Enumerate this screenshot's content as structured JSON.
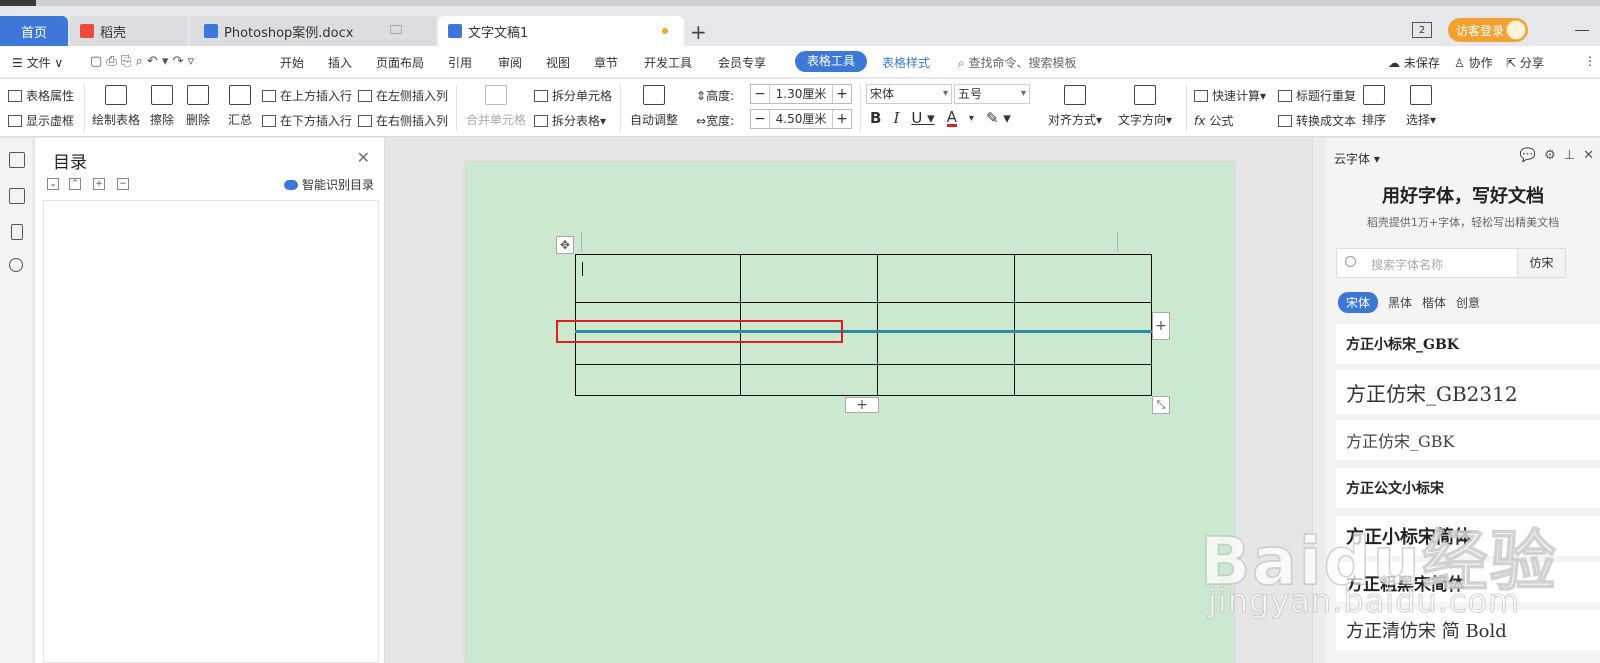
{
  "tabs": {
    "home": "首页",
    "tab2": "稻壳",
    "tab3": "Photoshop案例.docx",
    "tab4": "文字文稿1",
    "add": "+",
    "window_num": "2",
    "visitor": "访客登录"
  },
  "menu": {
    "file": "文件",
    "items": [
      "开始",
      "插入",
      "页面布局",
      "引用",
      "审阅",
      "视图",
      "章节",
      "开发工具",
      "会员专享"
    ],
    "table_tools": "表格工具",
    "table_style": "表格样式",
    "search_cmd": "查找命令、搜索模板",
    "unsaved": "未保存",
    "collab": "协作",
    "share": "分享"
  },
  "ribbon": {
    "table_props": "表格属性",
    "show_gridlines": "显示虚框",
    "draw_table": "绘制表格",
    "erase": "擦除",
    "delete": "删除",
    "summary": "汇总",
    "insert_above": "在上方插入行",
    "insert_below": "在下方插入行",
    "insert_left": "在左侧插入列",
    "insert_right": "在右侧插入列",
    "merge_cells": "合并单元格",
    "split_cells": "拆分单元格",
    "split_table": "拆分表格",
    "auto_adjust": "自动调整",
    "height_label": "高度:",
    "height_value": "1.30厘米",
    "width_label": "宽度:",
    "width_value": "4.50厘米",
    "font_name": "宋体",
    "font_size": "五号",
    "align": "对齐方式",
    "text_dir": "文字方向",
    "quick_calc": "快速计算",
    "header_repeat": "标题行重复",
    "formula": "公式",
    "to_text": "转换成文本",
    "sort": "排序",
    "select": "选择"
  },
  "toc": {
    "title": "目录",
    "ai_toc": "智能识别目录"
  },
  "fontpanel": {
    "header": "云字体",
    "title": "用好字体，写好文档",
    "subtitle": "稻壳提供1万+字体，轻松写出精美文档",
    "search_placeholder": "搜索字体名称",
    "search_button": "仿宋",
    "categories": [
      "宋体",
      "黑体",
      "楷体",
      "创意"
    ],
    "fonts": [
      "方正小标宋_GBK",
      "方正仿宋_GB2312",
      "方正仿宋_GBK",
      "方正公文小标宋",
      "方正小标宋简体",
      "方正粗黑宋简体",
      "方正清仿宋 简 Bold"
    ]
  },
  "watermark": {
    "main": "Baidu经验",
    "sub": "jingyan.baidu.com"
  },
  "colors": {
    "accent": "#3d78d8",
    "page_bg": "#cce8cf",
    "highlight": "#e02020",
    "selection_line": "#2f8a9e"
  }
}
